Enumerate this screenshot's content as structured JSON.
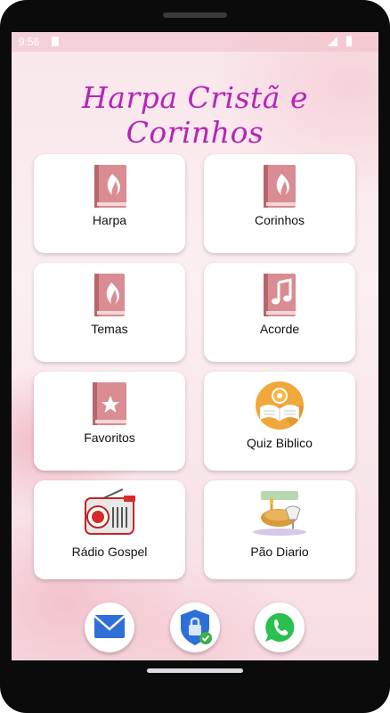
{
  "status_bar": {
    "time": "9:56"
  },
  "app": {
    "title": "Harpa Cristã e Corinhos"
  },
  "tiles": [
    {
      "label": "Harpa",
      "icon": "book-flame-icon"
    },
    {
      "label": "Corinhos",
      "icon": "book-flame-icon"
    },
    {
      "label": "Temas",
      "icon": "book-flame-icon"
    },
    {
      "label": "Acorde",
      "icon": "music-book-icon"
    },
    {
      "label": "Favoritos",
      "icon": "star-book-icon"
    },
    {
      "label": "Quiz Biblico",
      "icon": "open-bible-icon"
    },
    {
      "label": "Rádio Gospel",
      "icon": "radio-icon"
    },
    {
      "label": "Pão Diario",
      "icon": "bread-wine-icon"
    }
  ],
  "bottom_buttons": [
    {
      "icon": "mail-icon"
    },
    {
      "icon": "privacy-shield-icon"
    },
    {
      "icon": "whatsapp-icon"
    }
  ],
  "colors": {
    "title": "#b624b8",
    "book": "#d98c92",
    "book_dark": "#b8666c",
    "tile": "#ffffff"
  }
}
